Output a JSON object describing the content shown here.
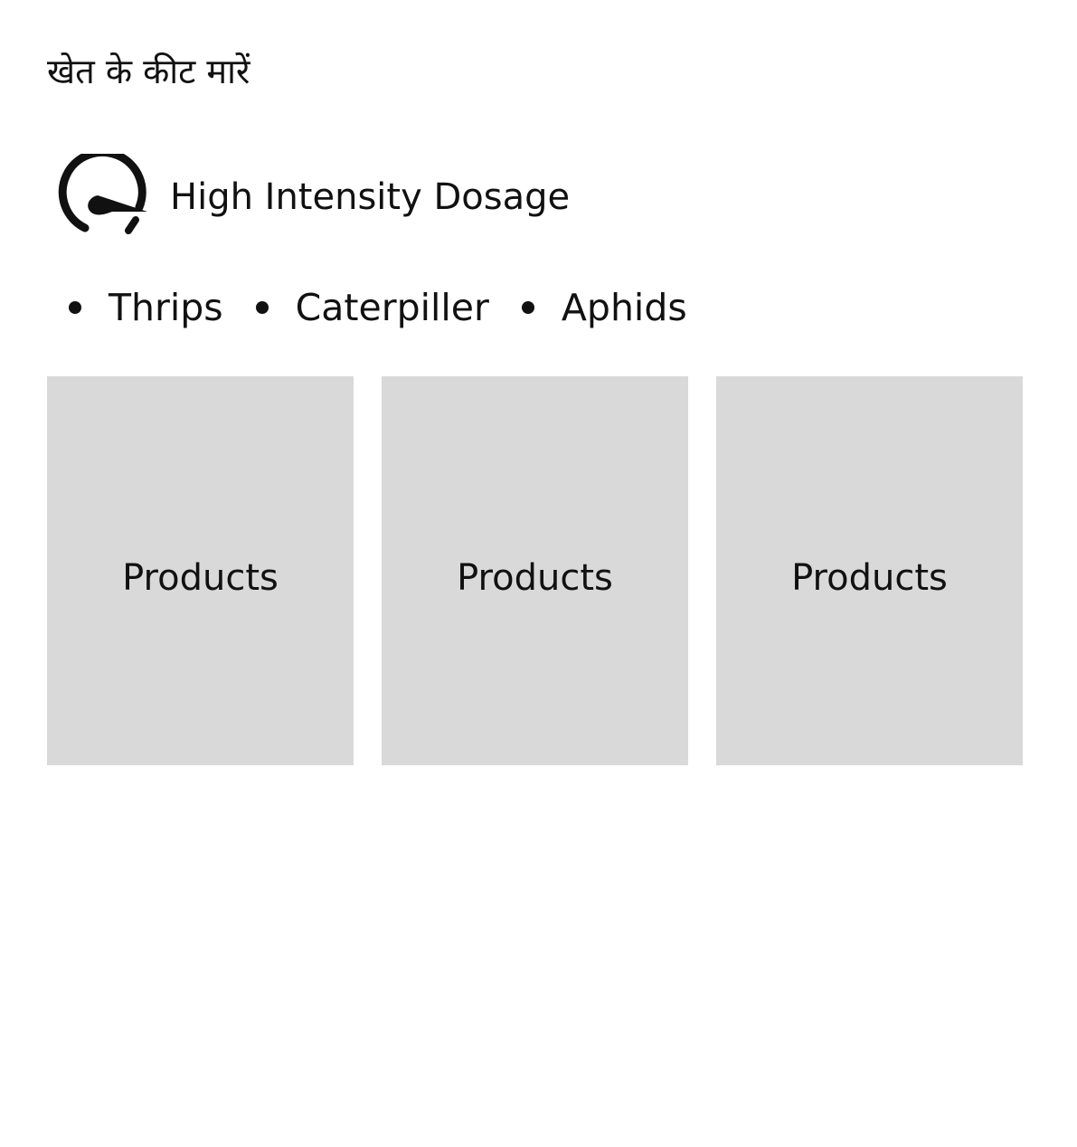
{
  "header": {
    "title": "खेत के कीट मारें"
  },
  "dosage": {
    "icon": "speedometer-icon",
    "label": "High Intensity Dosage"
  },
  "pests": [
    {
      "label": "Thrips"
    },
    {
      "label": "Caterpiller"
    },
    {
      "label": "Aphids"
    }
  ],
  "products": [
    {
      "label": "Products"
    },
    {
      "label": "Products"
    },
    {
      "label": "Products"
    }
  ],
  "colors": {
    "card_background": "#d9d9d9",
    "text": "#111111",
    "page_background": "#ffffff"
  }
}
